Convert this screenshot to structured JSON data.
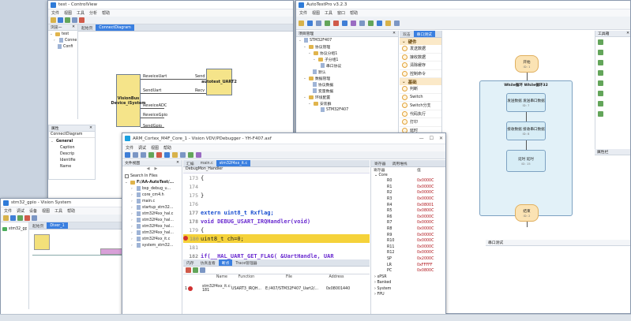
{
  "colors": {
    "accent": "#3a7fe0",
    "highlight": "#f5d23a",
    "register_value": "#b0151b",
    "flow_box": "#d7edf6",
    "start_box": "#fbe3b4"
  },
  "controlview": {
    "title": "test - ControlView",
    "menu": [
      "文件",
      "视图",
      "工具",
      "分析",
      "帮助"
    ],
    "panel_title": "浏览一",
    "tabs": [
      "起始页",
      "ConnectDiagram"
    ],
    "tree": [
      "test",
      "Conne",
      "Confi"
    ],
    "block_main": "VisionBus Device_iSystem",
    "block_right": "autotest_UART2",
    "ports": [
      "ReveiceUart",
      "SendUart",
      "ReveiceADC",
      "ReveiceGpio",
      "SendGpio"
    ],
    "right_ports": [
      "Send",
      "Recv"
    ],
    "props": {
      "title": "属性",
      "object": "ConnectDiagram",
      "group": "General",
      "items": [
        "Caption",
        "Descrip",
        "Identifie",
        "Name"
      ]
    }
  },
  "autotest": {
    "title": "AutoTestPro v3.2.3",
    "menu": [
      "文件",
      "视图",
      "工具",
      "窗口",
      "帮助"
    ],
    "project_panel": "项目管理",
    "tree": [
      "STM32F407",
      "协议管理",
      "协议分组1",
      "子分组1",
      "串口协议",
      "默认",
      "数据管理",
      "协议数据",
      "变量数据",
      "环境配置",
      "安装群",
      "STM32F407"
    ],
    "control_panel": "控件",
    "section_hw": "硬件",
    "hw_items": [
      "发送数据",
      "接收数据",
      "清除缓存",
      "控制命令"
    ],
    "section_basic": "基础",
    "basic_items": [
      "判断",
      "Switch",
      "Switch分支",
      "代码执行",
      "打印",
      "延时"
    ],
    "doc_tabs": [
      "双击",
      "串口测试"
    ],
    "flow": {
      "start": "开始",
      "loop": "While循环  While循环32",
      "send": "发送数据 发送串口数据",
      "recv": "接收数据 接收串口数据",
      "delay": "延时 延时",
      "end": "结束"
    },
    "flow_ids": [
      "ID: 1",
      "ID: 7",
      "ID: 8",
      "ID: 15",
      "ID: 2"
    ],
    "toolbox_title": "工具箱",
    "props_title": "属性栏",
    "output_title": "串口测试"
  },
  "keil": {
    "title": "ARM_Cortex_M4F_Core_1 - Vision VDV/PDebugger - YH-F407.axf",
    "menu": [
      "文件",
      "调试",
      "视图",
      "帮助"
    ],
    "file_panel": "文件视图",
    "search_label": "Search In Files",
    "project": "F:/AA-AutoTest/...",
    "files": [
      "bsp_debug_u...",
      "core_cm4.h",
      "main.c",
      "startup_stm32...",
      "stm32f4xx_hal.c",
      "stm32f4xx_hal...",
      "stm32f4xx_hal...",
      "stm32f4xx_hal...",
      "stm32f4xx_it.c",
      "system_stm32..."
    ],
    "editor_tabs": [
      "汇编",
      "main.c",
      "stm32f4xx_it.c"
    ],
    "func_selector": "DebugMon_Handler",
    "code": [
      {
        "n": "173",
        "t": "{"
      },
      {
        "n": "174",
        "t": ""
      },
      {
        "n": "175",
        "t": "}"
      },
      {
        "n": "176",
        "t": ""
      },
      {
        "n": "177",
        "t": "extern uint8_t Rxflag;"
      },
      {
        "n": "178",
        "t": "void  DEBUG_USART_IRQHandler(void)"
      },
      {
        "n": "179",
        "t": "{"
      },
      {
        "n": "180",
        "t": "  uint8_t ch=0;"
      },
      {
        "n": "181",
        "t": ""
      },
      {
        "n": "182",
        "t": "    if(__HAL_UART_GET_FLAG( &UartHandle, UAR"
      }
    ],
    "reg_tabs": [
      "寄存器",
      "调用堆栈"
    ],
    "reg_headers": [
      "寄存器",
      "值"
    ],
    "core_label": "Core",
    "regs": [
      "R0",
      "R1",
      "R2",
      "R3",
      "R4",
      "R5",
      "R6",
      "R7",
      "R8",
      "R9",
      "R10",
      "R11",
      "R12",
      "SP",
      "LR",
      "PC"
    ],
    "reg_vals": [
      "0x0000C",
      "0x0000C",
      "0x0000C",
      "0x0000C",
      "0x08001",
      "0x0800C",
      "0x0000C",
      "0x0000C",
      "0x0000C",
      "0x0000C",
      "0x0000C",
      "0x0000C",
      "0x0000C",
      "0x2000C",
      "0xFFFFF",
      "0x0800C"
    ],
    "reg_groups": [
      "xPSR",
      "Banked",
      "System",
      "FPU"
    ],
    "bp_tabs": [
      "内存",
      "仿真查看",
      "断点",
      "Trace管理器"
    ],
    "bp_headers": [
      "Name",
      "Function",
      "File",
      "Address"
    ],
    "bp_row": {
      "name": "stm32f4xx_it.c: 181",
      "func": "USART3_IRQH...",
      "file": "E:/407/STM32F407_Uart2/...",
      "addr": "0x08001440"
    }
  },
  "vision": {
    "title": "stm32_gpio - Vision System",
    "menu": [
      "文件",
      "调试",
      "设备",
      "视图",
      "工具",
      "帮助"
    ],
    "tree_item": "stm32_gp",
    "tabs": [
      "起始页",
      "Diver_1"
    ],
    "bottom_tabs": [
      "输出窗口",
      "Python窗口",
      "输出"
    ]
  }
}
